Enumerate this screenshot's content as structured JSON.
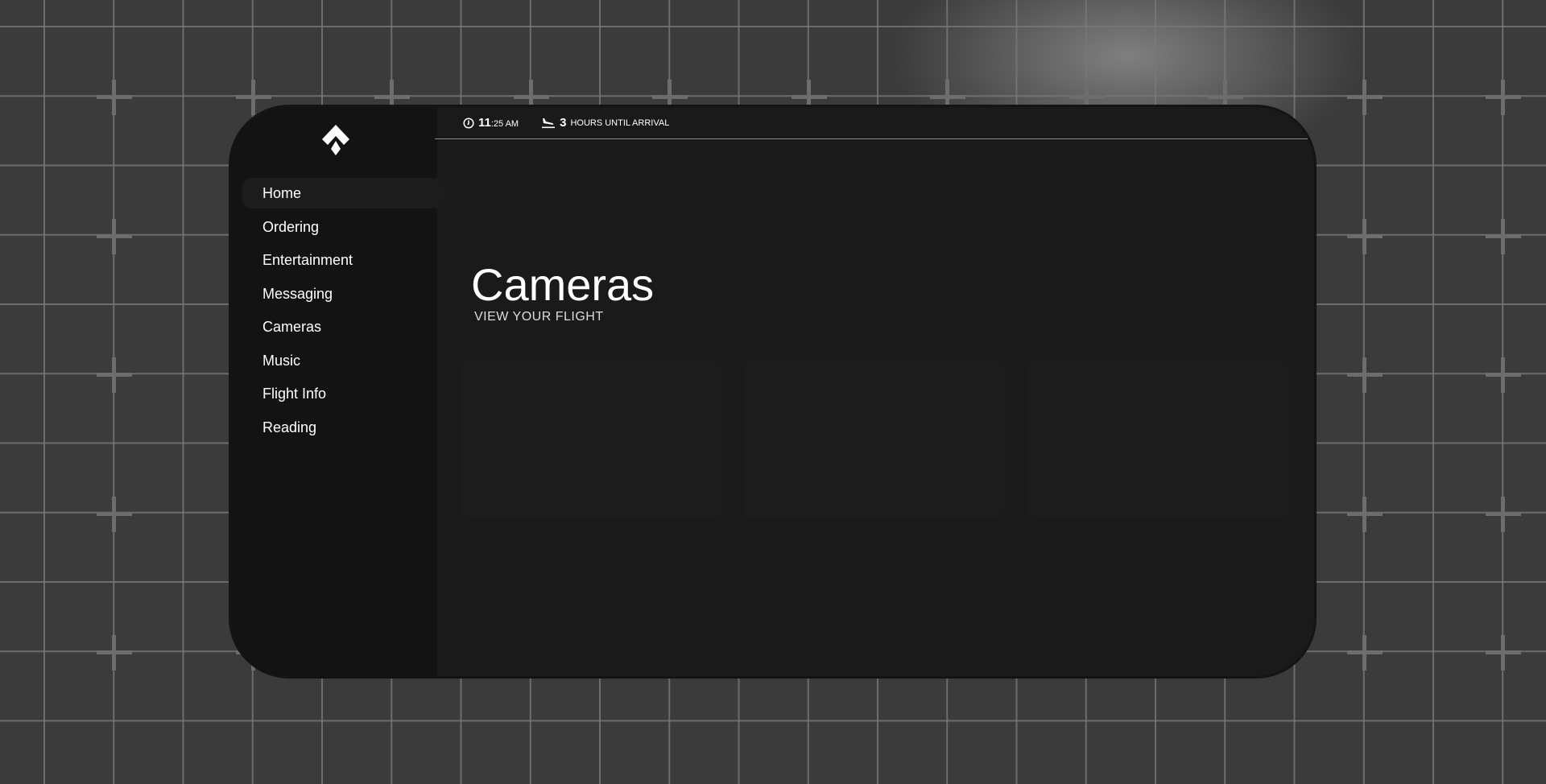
{
  "topbar": {
    "time_hour": "11",
    "time_rest": ":25 AM",
    "arrival_value": "3",
    "arrival_label": "HOURS UNTIL ARRIVAL"
  },
  "sidebar": {
    "items": [
      {
        "label": "Home",
        "active": true
      },
      {
        "label": "Ordering"
      },
      {
        "label": "Entertainment"
      },
      {
        "label": "Messaging"
      },
      {
        "label": "Cameras"
      },
      {
        "label": "Music"
      },
      {
        "label": "Flight Info"
      },
      {
        "label": "Reading"
      }
    ]
  },
  "main": {
    "title": "Cameras",
    "subtitle": "VIEW YOUR FLIGHT",
    "cards": 3
  },
  "colors": {
    "panel": "#1a1a1a",
    "sidebar": "#131313",
    "background": "#3b3b3b"
  }
}
